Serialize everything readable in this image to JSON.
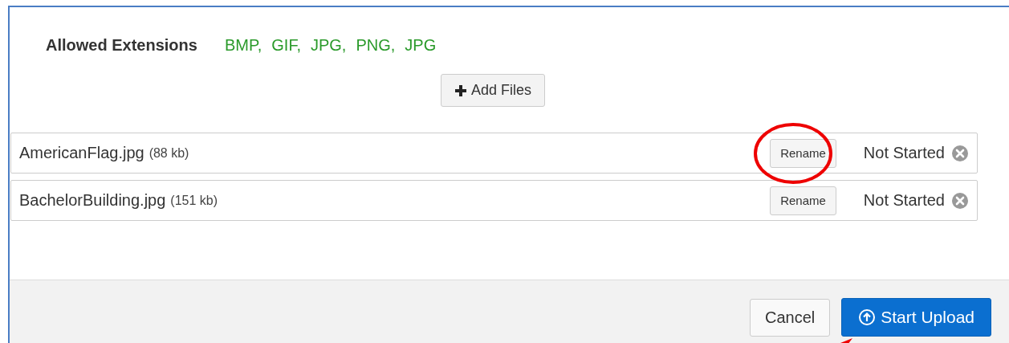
{
  "allowed_extensions": {
    "label": "Allowed Extensions",
    "values": [
      "BMP,",
      "GIF,",
      "JPG,",
      "PNG,",
      "JPG"
    ]
  },
  "add_button": {
    "label": "Add Files"
  },
  "files": [
    {
      "name": "AmericanFlag.jpg",
      "size": "(88 kb)",
      "rename": "Rename",
      "status": "Not Started",
      "highlighted": true
    },
    {
      "name": "BachelorBuilding.jpg",
      "size": "(151 kb)",
      "rename": "Rename",
      "status": "Not Started",
      "highlighted": false
    }
  ],
  "footer": {
    "cancel": "Cancel",
    "start": "Start Upload"
  }
}
